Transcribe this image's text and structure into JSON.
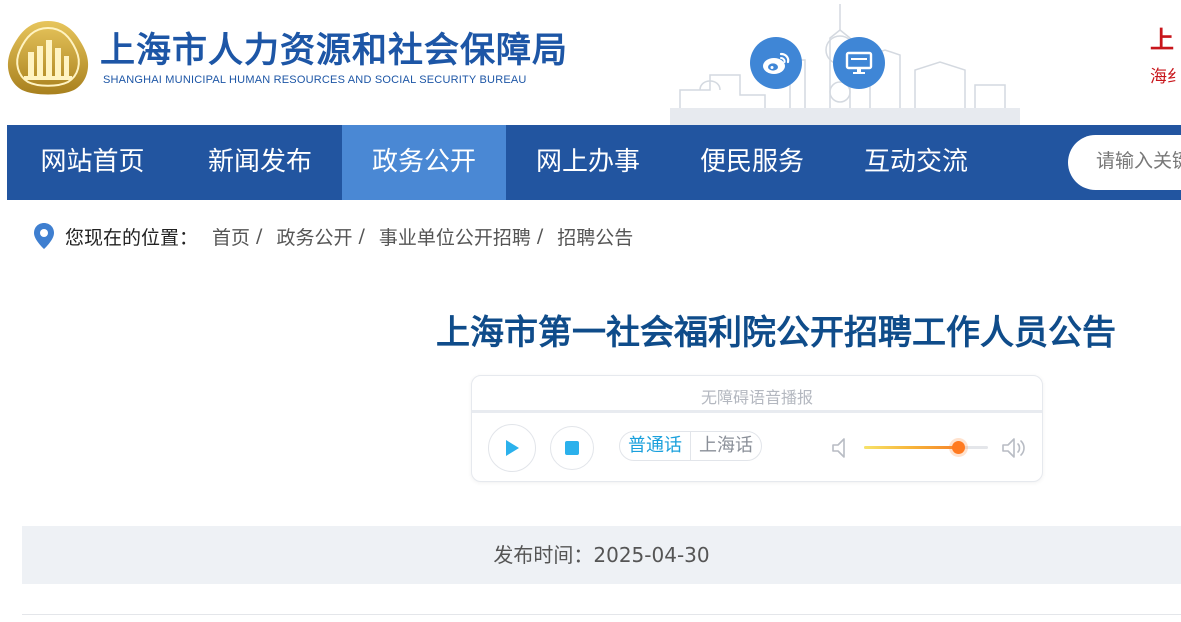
{
  "header": {
    "site_name": "上海市人力资源和社会保障局",
    "site_name_en": "SHANGHAI MUNICIPAL HUMAN RESOURCES AND SOCIAL SECURITY BUREAU",
    "corner_title": "上",
    "corner_subtitle": "海纟",
    "brand_color": "#1d56a6",
    "icons": [
      "emblem-icon",
      "weibo-icon",
      "desktop-icon",
      "skyline-icon"
    ]
  },
  "nav": {
    "items": [
      {
        "label": "网站首页"
      },
      {
        "label": "新闻发布"
      },
      {
        "label": "政务公开",
        "active": true
      },
      {
        "label": "网上办事"
      },
      {
        "label": "便民服务"
      },
      {
        "label": "互动交流"
      }
    ],
    "background": "#2255a0",
    "active_background": "#4a88d4"
  },
  "search": {
    "placeholder": "请输入关键字"
  },
  "breadcrumb": {
    "label": "您现在的位置：",
    "items": [
      {
        "label": "首页"
      },
      {
        "label": "政务公开"
      },
      {
        "label": "事业单位公开招聘"
      },
      {
        "label": "招聘公告"
      }
    ],
    "separator": "/"
  },
  "article": {
    "title": "上海市第一社会福利院公开招聘工作人员公告",
    "publish_label": "发布时间：",
    "publish_date": "2025-04-30",
    "full_date_text": "发布时间：2025-04-30"
  },
  "player": {
    "label": "无障碍语音播报",
    "languages": [
      {
        "label": "普通话",
        "active": true
      },
      {
        "label": "上海话",
        "active": false
      }
    ],
    "volume": 0.76,
    "progress": 0.0,
    "accent_color": "#1aa0dc"
  }
}
